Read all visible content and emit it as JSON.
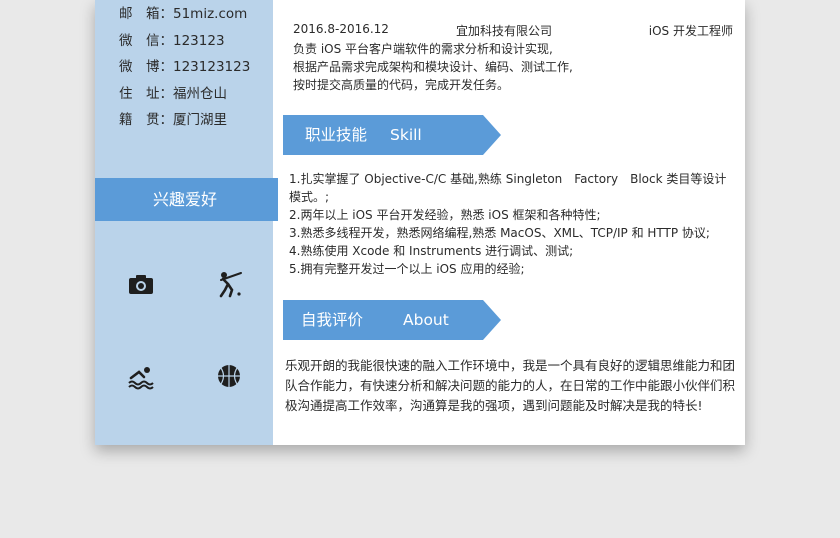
{
  "contact": [
    {
      "label": "邮　箱：",
      "value": "51miz.com"
    },
    {
      "label": "微　信：",
      "value": "123123"
    },
    {
      "label": "微　博：",
      "value": "123123123"
    },
    {
      "label": "住　址：",
      "value": "福州仓山"
    },
    {
      "label": "籍　贯：",
      "value": "厦门湖里"
    }
  ],
  "hobbies": {
    "title": "兴趣爱好",
    "icons": [
      "camera-icon",
      "baseball-icon",
      "swimming-icon",
      "basketball-icon"
    ]
  },
  "experience": {
    "period": "2016.8-2016.12",
    "company": "宜加科技有限公司",
    "position": "iOS 开发工程师",
    "lines": [
      "负责 iOS 平台客户端软件的需求分析和设计实现,",
      "根据产品需求完成架构和模块设计、编码、测试工作,",
      "按时提交高质量的代码，完成开发任务。"
    ]
  },
  "skills": {
    "title_cn": "职业技能",
    "title_en": "Skill",
    "items": [
      "1.扎实掌握了 Objective-C/C 基础,熟练 Singleton　Factory　Block 类目等设计模式。;",
      "2.两年以上 iOS 平台开发经验，熟悉 iOS 框架和各种特性;",
      "3.熟悉多线程开发，熟悉网络编程,熟悉 MacOS、XML、TCP/IP 和 HTTP 协议;",
      "4.熟练使用 Xcode 和 Instruments 进行调试、测试;",
      "5.拥有完整开发过一个以上 iOS 应用的经验;"
    ]
  },
  "about": {
    "title_cn": "自我评价",
    "title_en": "About",
    "text": "乐观开朗的我能很快速的融入工作环境中，我是一个具有良好的逻辑思维能力和团队合作能力，有快速分析和解决问题的能力的人，在日常的工作中能跟小伙伴们积极沟通提高工作效率，沟通算是我的强项，遇到问题能及时解决是我的特长!"
  },
  "colors": {
    "sidebar": "#bad3ea",
    "accent": "#5b9bd8"
  }
}
